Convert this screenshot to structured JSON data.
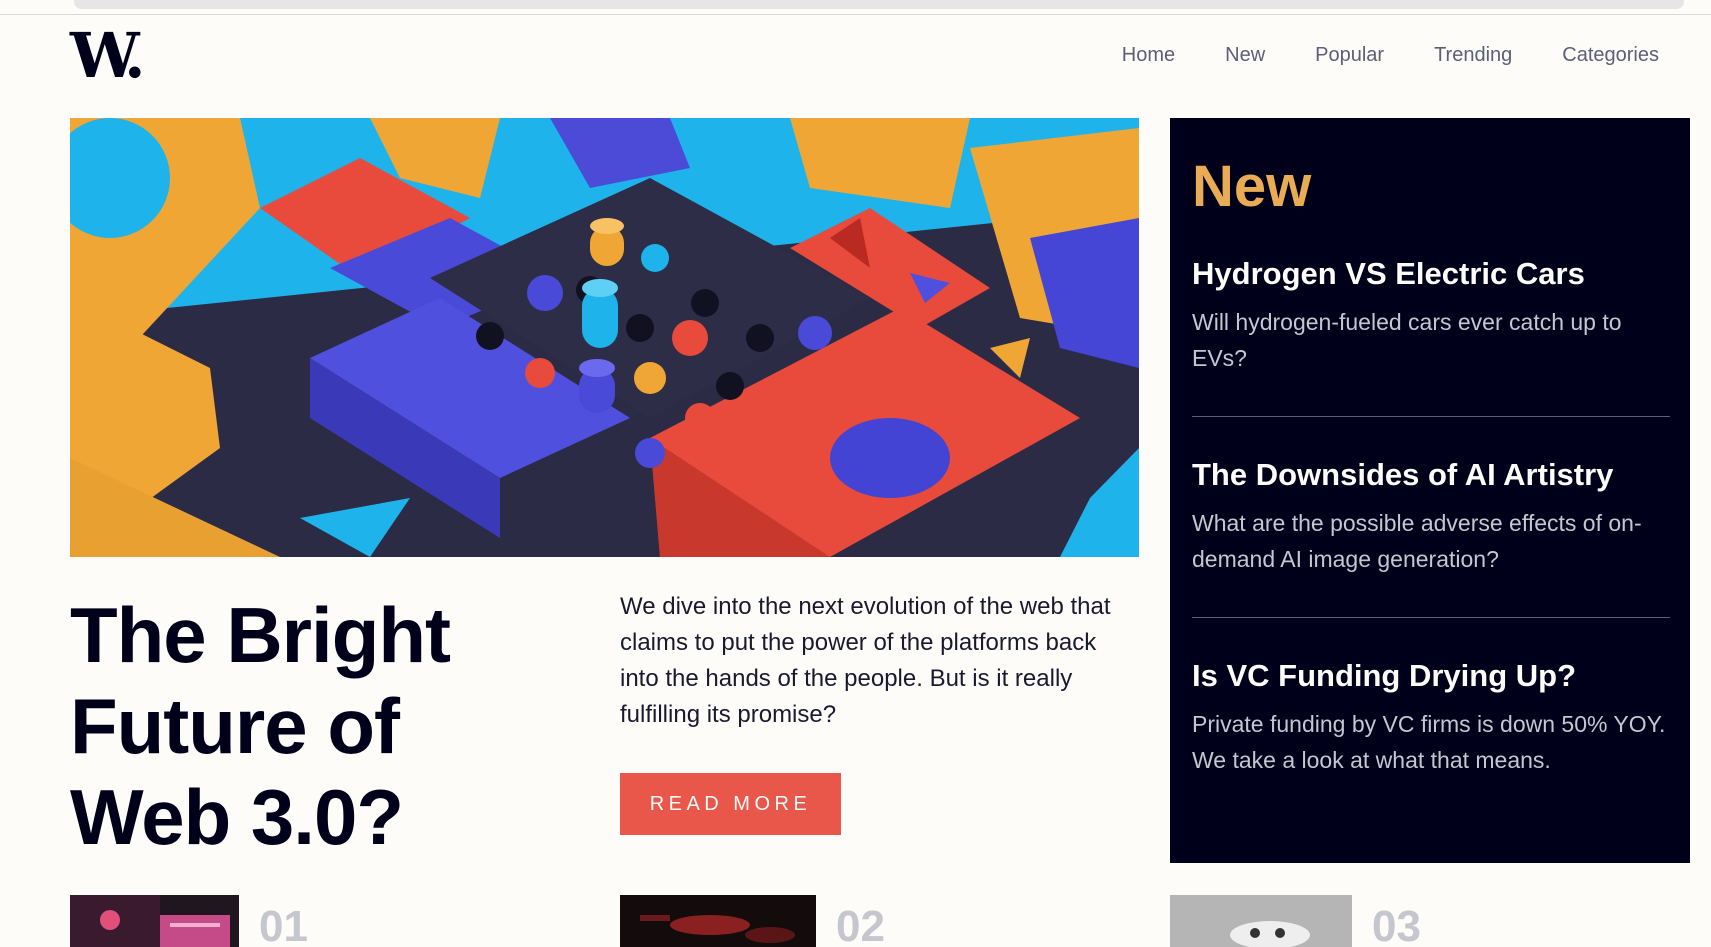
{
  "header": {
    "logo": "W.",
    "nav": [
      "Home",
      "New",
      "Popular",
      "Trending",
      "Categories"
    ]
  },
  "hero": {
    "title": "The Bright Future of Web 3.0?",
    "description": "We dive into the next evolution of the web that claims to put the power of the platforms back into the hands of the people. But is it really fulfilling its promise?",
    "button_label": "READ MORE"
  },
  "new_panel": {
    "heading": "New",
    "items": [
      {
        "title": "Hydrogen VS Electric Cars",
        "text": "Will hydrogen-fueled cars ever catch up to EVs?"
      },
      {
        "title": "The Downsides of AI Artistry",
        "text": "What are the possible adverse effects of on-demand AI image generation?"
      },
      {
        "title": "Is VC Funding Drying Up?",
        "text": "Private funding by VC firms is down 50% YOY. We take a look at what that means."
      }
    ]
  },
  "bottom": {
    "numbers": [
      "01",
      "02",
      "03"
    ]
  },
  "colors": {
    "background": "#fdfcf8",
    "dark": "#00001a",
    "accent_orange": "#e9ab53",
    "accent_red": "#e9564a",
    "muted": "#5d5f79"
  }
}
